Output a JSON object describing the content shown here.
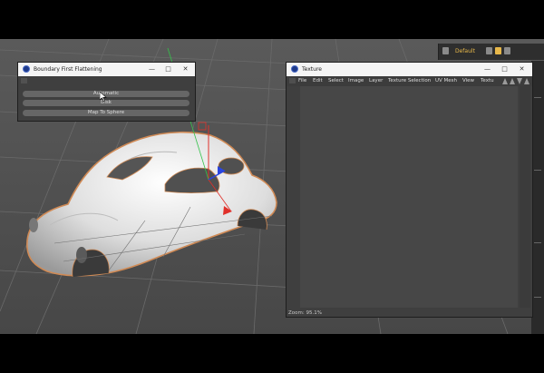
{
  "boundary_window": {
    "title": "Boundary First Flattening",
    "buttons": [
      "Automatic",
      "Disk",
      "Map To Sphere"
    ]
  },
  "texture_window": {
    "title": "Texture",
    "menu": [
      "File",
      "Edit",
      "Select",
      "Image",
      "Layer",
      "Texture Selection",
      "UV Mesh",
      "View",
      "Textu"
    ],
    "status": "Zoom: 95.1%"
  },
  "top_toolbar": {
    "layout_label": "Default"
  },
  "colors": {
    "viewport_bg": "#4b4b4b",
    "window_bg": "#3f3f3f",
    "titlebar_bg": "#f4f4f4",
    "selection_outline": "#d08a55",
    "axis_x": "#e0302a",
    "axis_y": "#34c24a",
    "axis_z": "#2a45e0",
    "accent": "#e8b84a"
  }
}
